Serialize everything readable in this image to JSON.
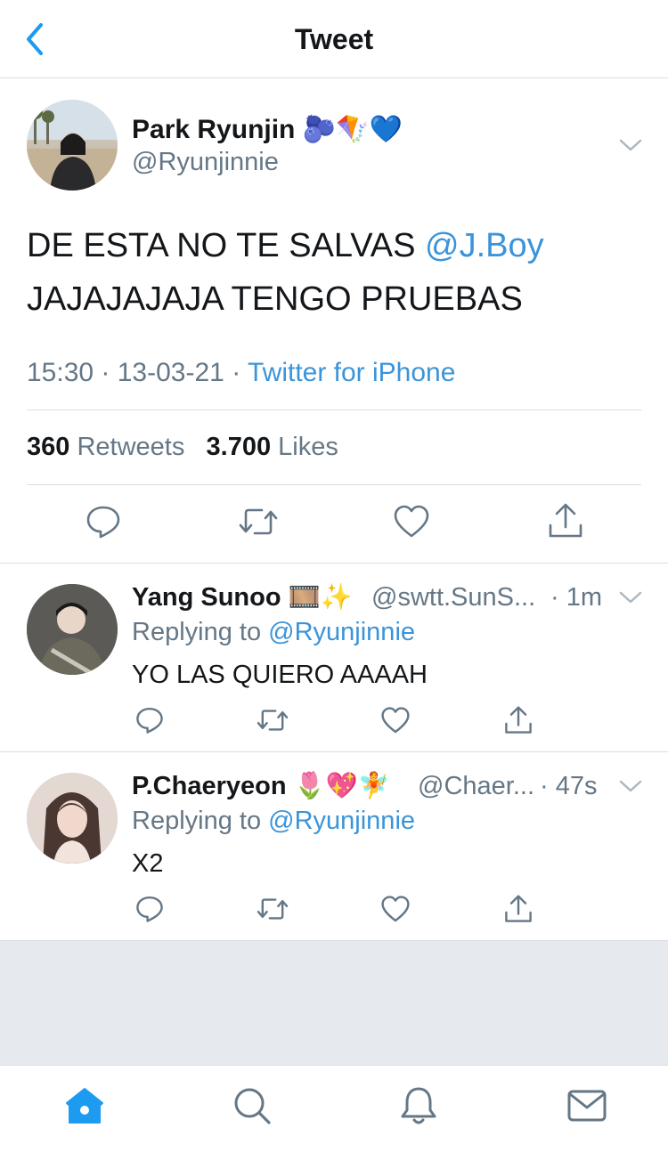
{
  "header": {
    "title": "Tweet"
  },
  "main_tweet": {
    "name": "Park Ryunjin",
    "name_emoji": "🫐🪁💙",
    "handle": "@Ryunjinnie",
    "text_line1": "DE ESTA NO TE SALVAS ",
    "mention": "@J.Boy",
    "text_line2": "JAJAJAJAJA TENGO PRUEBAS",
    "time": "15:30",
    "date": "13-03-21",
    "source": "Twitter for iPhone",
    "retweets_count": "360",
    "retweets_label": "Retweets",
    "likes_count": "3.700",
    "likes_label": "Likes"
  },
  "replies": [
    {
      "name": "Yang Sunoo",
      "name_emoji": "🎞️✨",
      "handle": "@swtt.SunS...",
      "time": "· 1m",
      "replying_prefix": "Replying to ",
      "replying_to": "@Ryunjinnie",
      "text": "YO LAS QUIERO AAAAH"
    },
    {
      "name": "P.Chaeryeon",
      "name_emoji": "🌷💖🧚",
      "handle": "@Chaer...",
      "time": "· 47s",
      "replying_prefix": "Replying to ",
      "replying_to": "@Ryunjinnie",
      "text": "X2"
    }
  ],
  "icons": {
    "back": "chevron-left-icon",
    "more": "chevron-down-icon",
    "reply": "comment-icon",
    "retweet": "retweet-icon",
    "like": "heart-icon",
    "share": "share-icon",
    "home": "home-icon",
    "search": "search-icon",
    "notifications": "bell-icon",
    "messages": "mail-icon"
  },
  "colors": {
    "accent": "#1d9bf0",
    "link": "#3b94d9",
    "secondary_text": "#657786"
  }
}
